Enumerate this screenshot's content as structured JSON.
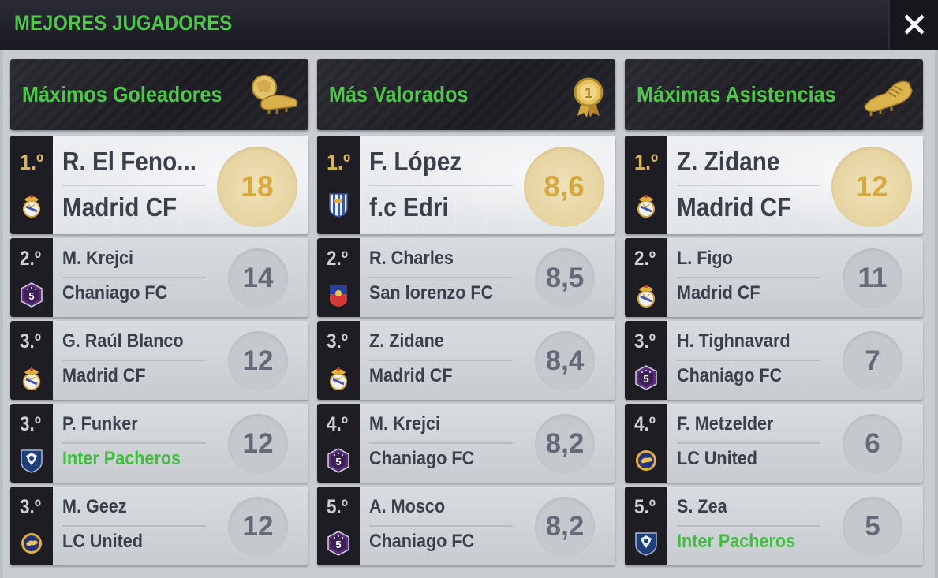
{
  "window": {
    "title": "MEJORES JUGADORES"
  },
  "colors": {
    "accent_green": "#4fc84a",
    "gold": "#d6a840",
    "dark": "#1e1d23"
  },
  "columns": [
    {
      "title": "Máximos Goleadores",
      "icon": "ball-and-boot-icon",
      "rows": [
        {
          "rank": "1.º",
          "name": "R. El Feno...",
          "club": "Madrid CF",
          "value": "18",
          "badge": "madrid-crest"
        },
        {
          "rank": "2.º",
          "name": "M. Krejci",
          "club": "Chaniago FC",
          "value": "14",
          "badge": "chaniago-crest"
        },
        {
          "rank": "3.º",
          "name": "G. Raúl Blanco",
          "club": "Madrid CF",
          "value": "12",
          "badge": "madrid-crest"
        },
        {
          "rank": "3.º",
          "name": "P. Funker",
          "club": "Inter Pacheros",
          "value": "12",
          "badge": "pacheros-crest"
        },
        {
          "rank": "3.º",
          "name": "M. Geez",
          "club": "LC United",
          "value": "12",
          "badge": "lc-united-crest"
        }
      ]
    },
    {
      "title": "Más Valorados",
      "icon": "medal-icon",
      "rows": [
        {
          "rank": "1.º",
          "name": "F. López",
          "club": "f.c Edri",
          "value": "8,6",
          "badge": "edri-crest"
        },
        {
          "rank": "2.º",
          "name": "R. Charles",
          "club": "San lorenzo FC",
          "value": "8,5",
          "badge": "san-lorenzo-crest"
        },
        {
          "rank": "3.º",
          "name": "Z. Zidane",
          "club": "Madrid CF",
          "value": "8,4",
          "badge": "madrid-crest"
        },
        {
          "rank": "4.º",
          "name": "M. Krejci",
          "club": "Chaniago FC",
          "value": "8,2",
          "badge": "chaniago-crest"
        },
        {
          "rank": "5.º",
          "name": "A. Mosco",
          "club": "Chaniago FC",
          "value": "8,2",
          "badge": "chaniago-crest"
        }
      ]
    },
    {
      "title": "Máximas Asistencias",
      "icon": "golden-boot-icon",
      "rows": [
        {
          "rank": "1.º",
          "name": "Z. Zidane",
          "club": "Madrid CF",
          "value": "12",
          "badge": "madrid-crest"
        },
        {
          "rank": "2.º",
          "name": "L. Figo",
          "club": "Madrid CF",
          "value": "11",
          "badge": "madrid-crest"
        },
        {
          "rank": "3.º",
          "name": "H. Tighnavard",
          "club": "Chaniago FC",
          "value": "7",
          "badge": "chaniago-crest"
        },
        {
          "rank": "4.º",
          "name": "F. Metzelder",
          "club": "LC United",
          "value": "6",
          "badge": "lc-united-crest"
        },
        {
          "rank": "5.º",
          "name": "S. Zea",
          "club": "Inter Pacheros",
          "value": "5",
          "badge": "pacheros-crest"
        }
      ]
    }
  ]
}
